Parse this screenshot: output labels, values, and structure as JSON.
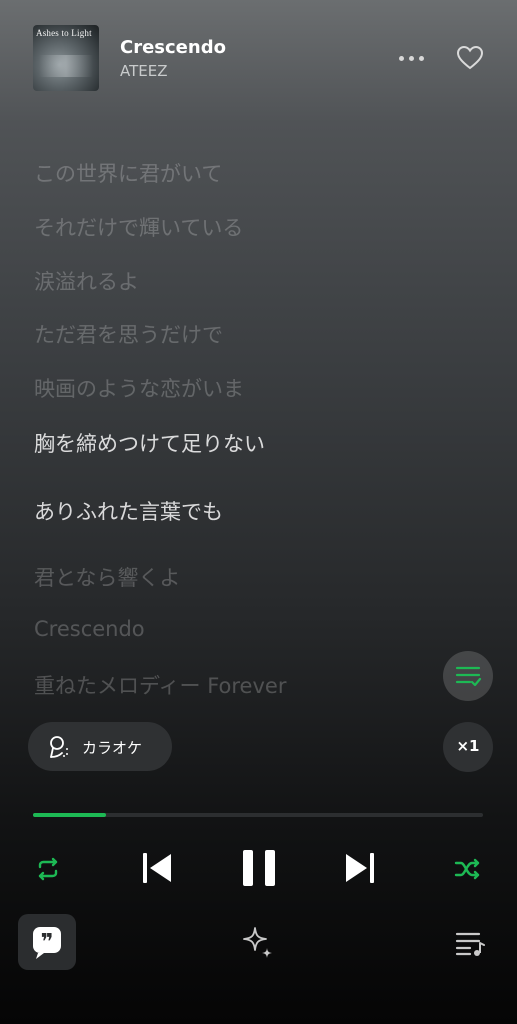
{
  "now_playing": {
    "title": "Crescendo",
    "artist": "ATEEZ",
    "cover_text": "Ashes to Light"
  },
  "lyrics": [
    {
      "text": "この世界に君がいて",
      "state": "past"
    },
    {
      "text": "それだけで輝いている",
      "state": "past"
    },
    {
      "text": "涙溢れるよ",
      "state": "past"
    },
    {
      "text": "ただ君を思うだけで",
      "state": "past"
    },
    {
      "text": "映画のような恋がいま",
      "state": "past"
    },
    {
      "text": "胸を締めつけて足りない",
      "state": "current"
    },
    {
      "text": "ありふれた言葉でも",
      "state": "current"
    },
    {
      "text": "君となら響くよ",
      "state": "upcoming"
    },
    {
      "text": "Crescendo",
      "state": "upcoming"
    },
    {
      "text": "重ねたメロディー Forever",
      "state": "upcoming"
    }
  ],
  "karaoke": {
    "label": "カラオケ"
  },
  "speed": {
    "label": "×1"
  },
  "playback": {
    "progress": 0.163
  },
  "colors": {
    "accent": "#1db954",
    "chip_bg": "#2f3133"
  },
  "icons": {
    "more": "more-icon",
    "heart": "heart-icon",
    "lyrics_view": "lyrics-view-icon",
    "karaoke": "microphone-icon",
    "repeat": "repeat-icon",
    "previous": "skip-previous-icon",
    "pause": "pause-icon",
    "next": "skip-next-icon",
    "shuffle": "shuffle-icon",
    "lyrics_tab": "quote-icon",
    "sparkle": "sparkle-icon",
    "queue": "queue-icon"
  }
}
